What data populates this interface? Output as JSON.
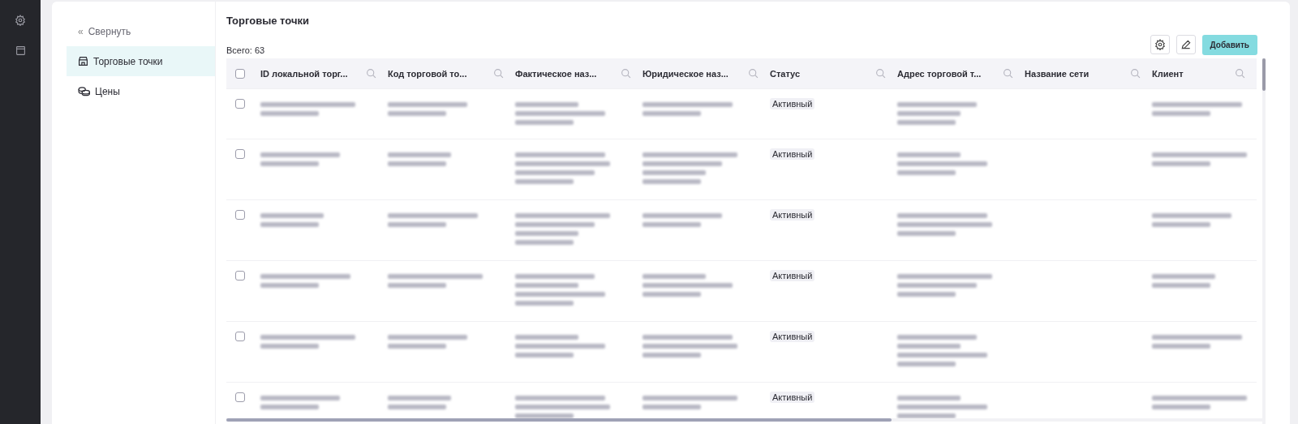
{
  "rail": {
    "items": [
      {
        "kind": "settings",
        "selected": false
      },
      {
        "kind": "calendar",
        "selected": false
      }
    ]
  },
  "sidebar": {
    "collapse": {
      "icon": "«",
      "label": "Свернуть"
    },
    "items": [
      {
        "kind": "store",
        "label": "Торговые точки",
        "selected": true
      },
      {
        "kind": "coins",
        "label": "Цены",
        "selected": false
      }
    ]
  },
  "page": {
    "title": "Торговые точки",
    "total": "Всего: 63",
    "add_button": "Добавить"
  },
  "table": {
    "select_all": {
      "checked": false
    },
    "columns": [
      "ID локальной торг...",
      "Код торговой то...",
      "Фактическое наз...",
      "Юридическое наз...",
      "Статус",
      "Адрес торговой т...",
      "Название сети",
      "Клиент"
    ],
    "rows": [
      {
        "checked": false,
        "status": "Активный"
      },
      {
        "checked": false,
        "status": "Активный"
      },
      {
        "checked": false,
        "status": "Активный"
      },
      {
        "checked": false,
        "status": "Активный"
      },
      {
        "checked": false,
        "status": "Активный"
      },
      {
        "checked": false,
        "status": "Активный"
      }
    ]
  }
}
